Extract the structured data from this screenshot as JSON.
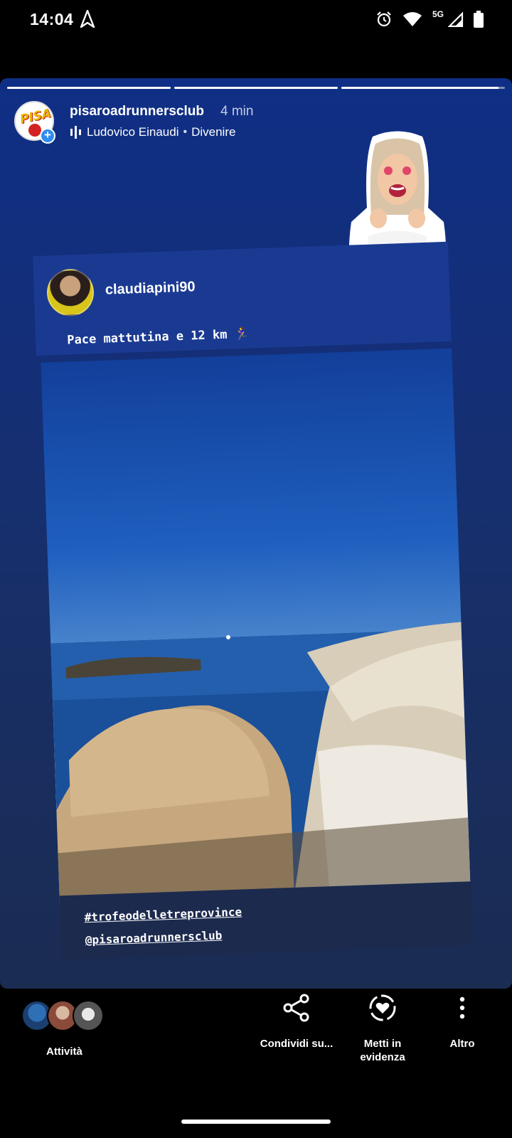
{
  "status": {
    "time": "14:04",
    "network": "5G",
    "icons": [
      "navigation-arrow-icon",
      "alarm-icon",
      "wifi-icon",
      "signal-icon",
      "battery-icon"
    ]
  },
  "story": {
    "progress": {
      "segments": 3,
      "current_index": 2,
      "current_fraction": 0.96
    },
    "username": "pisaroadrunnersclub",
    "time_ago": "4 min",
    "music": {
      "artist": "Ludovico Einaudi",
      "separator": "•",
      "title": "Divenire"
    }
  },
  "repost": {
    "username": "claudiapini90",
    "caption": "Pace mattutina e 12 km 🏃‍♀️",
    "hashtag": "#trofeodelletreprovince",
    "mention": "@pisaroadrunnersclub"
  },
  "actions": {
    "activity": "Attività",
    "share": "Condividi su...",
    "highlight_line1": "Metti in",
    "highlight_line2": "evidenza",
    "more": "Altro"
  },
  "colors": {
    "story_bg_top": "#0f2f86",
    "story_bg_bottom": "#1a2c52",
    "badge_blue": "#2d8cf0"
  }
}
